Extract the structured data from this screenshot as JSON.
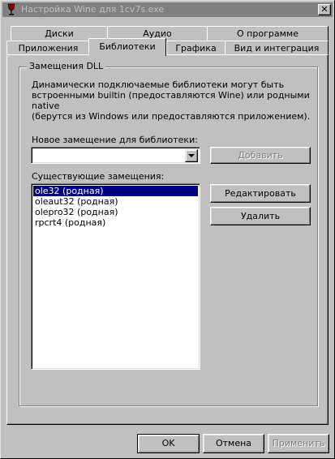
{
  "window": {
    "title": "Настройка Wine для 1cv7s.exe",
    "close_symbol": "✕",
    "icon": "wine-glass-icon"
  },
  "tabs": {
    "row1": [
      "Диски",
      "Аудио",
      "О программе"
    ],
    "row2": [
      "Приложения",
      "Библиотеки",
      "Графика",
      "Вид и интеграция"
    ],
    "active": "Библиотеки"
  },
  "dll_group": {
    "title": "Замещения DLL",
    "description_line1": "Динамически подключаемые библиотеки могут быть",
    "description_line2": "встроенными builtin (предоставляются Wine) или родными native",
    "description_line3": "(берутся из Windows или предоставляются приложением).",
    "new_override_label": "Новое замещение для библиотеки:",
    "new_override_value": "",
    "add_button": "Добавить",
    "existing_label": "Существующие замещения:",
    "overrides": [
      "ole32 (родная)",
      "oleaut32 (родная)",
      "olepro32 (родная)",
      "rpcrt4 (родная)"
    ],
    "selected_index": 0,
    "edit_button": "Редактировать",
    "remove_button": "Удалить"
  },
  "footer": {
    "ok_button": "OK",
    "cancel_button": "Отмена",
    "apply_button": "Применить"
  },
  "colors": {
    "face": "#c0c0c0",
    "titlebar_inactive": "#808080",
    "selection": "#000080"
  }
}
